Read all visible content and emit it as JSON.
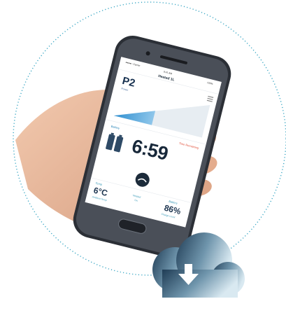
{
  "colors": {
    "circle_dots": "#3aa7c4",
    "cloud_gradient_start": "#1f3c55",
    "cloud_gradient_end": "#cfe3ee",
    "screen_bg": "#ffffff",
    "accent_blue": "#3aa0d8",
    "alert_red": "#e0503a",
    "skin": "#e8b89a",
    "phone_frame": "#2b2f36"
  },
  "phone": {
    "status_left": "●●●●○ Carrier",
    "status_time": "9:41 AM",
    "status_right": "100%",
    "title": "Heated 1L",
    "mode": {
      "label": "P2",
      "sub": "Power"
    },
    "battery_label": "Battery",
    "remaining_label": "Time Remaining",
    "time_remaining": "6:59",
    "temperature": {
      "top": "Temp",
      "value": "6°C",
      "sub": "Ambient Temp"
    },
    "middle": {
      "label": "Heated",
      "sub": "On"
    },
    "charge": {
      "top": "Battery",
      "value": "86%",
      "sub": "Charge Level"
    }
  },
  "cloud_button": {
    "icon": "download-arrow-icon"
  }
}
